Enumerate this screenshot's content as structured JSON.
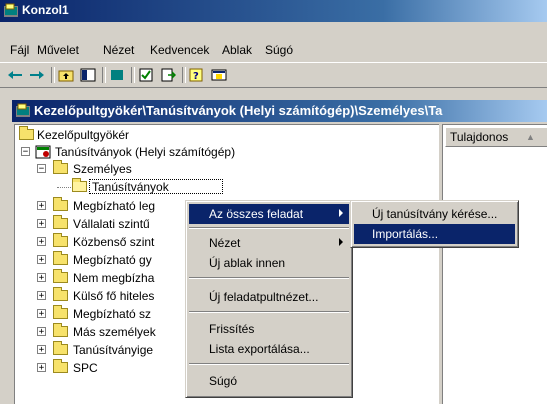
{
  "window": {
    "title": "Konzol1"
  },
  "menubar": [
    "Fájl",
    "Művelet",
    "Nézet",
    "Kedvencek",
    "Ablak",
    "Súgó"
  ],
  "toolbar": {
    "icons": [
      "back-arrow-icon",
      "forward-arrow-icon",
      "up-folder-icon",
      "show-hide-tree-icon",
      "delete-icon",
      "properties-icon",
      "export-list-icon",
      "help-icon",
      "console-icon"
    ]
  },
  "inner_window": {
    "title": "Kezelőpultgyökér\\Tanúsítványok (Helyi számítógép)\\Személyes\\Ta"
  },
  "tree": {
    "root": "Kezelőpultgyökér",
    "certs": "Tanúsítványok (Helyi számítógép)",
    "personal": "Személyes",
    "personal_certs": "Tanúsítványok",
    "items": [
      "Megbízható leg",
      "Vállalati szintű",
      "Közbenső szint",
      "Megbízható gy",
      "Nem megbízha",
      "Külső fő hiteles",
      "Megbízható sz",
      "Más személyek",
      "Tanúsítványige",
      "SPC"
    ]
  },
  "list": {
    "column_owner": "Tulajdonos"
  },
  "context_menu": {
    "all_tasks": "Az összes feladat",
    "view": "Nézet",
    "new_window": "Új ablak innen",
    "new_taskpad": "Új feladatpultnézet...",
    "refresh": "Frissítés",
    "export_list": "Lista exportálása...",
    "help": "Súgó"
  },
  "submenu": {
    "request": "Új tanúsítvány kérése...",
    "import": "Importálás..."
  },
  "colors": {
    "title_active": "#0a246a",
    "menu_highlight": "#0a246a",
    "face": "#d4d0c8"
  }
}
